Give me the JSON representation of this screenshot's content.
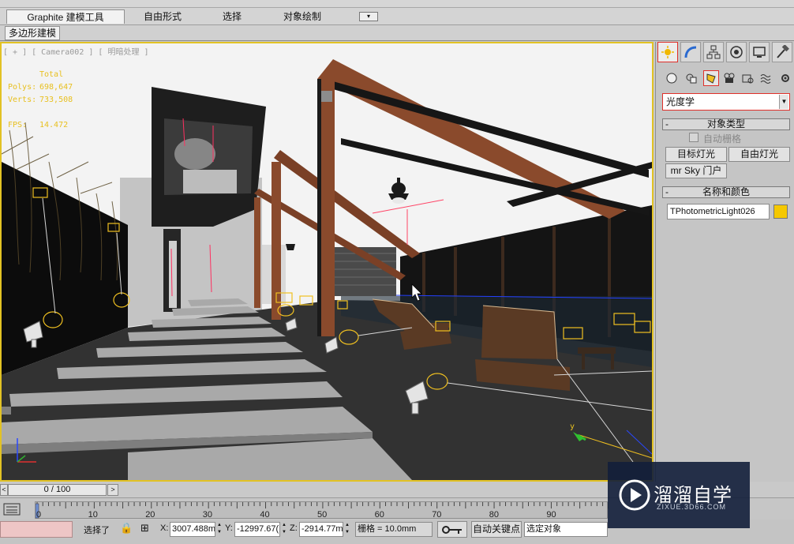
{
  "ribbon": {
    "tabs": [
      "Graphite 建模工具",
      "自由形式",
      "选择",
      "对象绘制"
    ],
    "subtab": "多边形建模"
  },
  "viewport": {
    "label": "[ + ] [ Camera002 ] [ 明暗处理 ]",
    "stats": {
      "total_label": "Total",
      "polys_label": "Polys:",
      "polys_value": "698,647",
      "verts_label": "Verts:",
      "verts_value": "733,508",
      "fps_label": "FPS:",
      "fps_value": "14.472"
    },
    "axis_y": "y"
  },
  "command_panel": {
    "category": "光度学",
    "object_type_title": "对象类型",
    "autogrid_label": "自动栅格",
    "buttons": [
      "目标灯光",
      "自由灯光",
      "mr Sky 门户"
    ],
    "name_color_title": "名称和颜色",
    "object_name": "TPhotometricLight026",
    "swatch_color": "#f5c800",
    "minus": "-"
  },
  "timeline": {
    "slider_text": "0 / 100",
    "left_arrow": "<",
    "right_arrow": ">",
    "ticks": [
      "0",
      "10",
      "20",
      "30",
      "40",
      "50",
      "60",
      "70",
      "80",
      "90"
    ]
  },
  "status": {
    "selected": "选择了",
    "x_label": "X:",
    "x_value": "3007.488m",
    "y_label": "Y:",
    "y_value": "-12997.67(",
    "z_label": "Z:",
    "z_value": "-2914.77m",
    "grid": "栅格 = 10.0mm",
    "autokey": "自动关键点",
    "selection_set": "选定对象"
  },
  "watermark": {
    "title": "溜溜自学",
    "subtitle": "ZIXUE.3D66.COM"
  },
  "colors": {
    "viewport_border": "#e2c224",
    "selection_red": "#e0302a",
    "beam": "#8a4a2c"
  }
}
